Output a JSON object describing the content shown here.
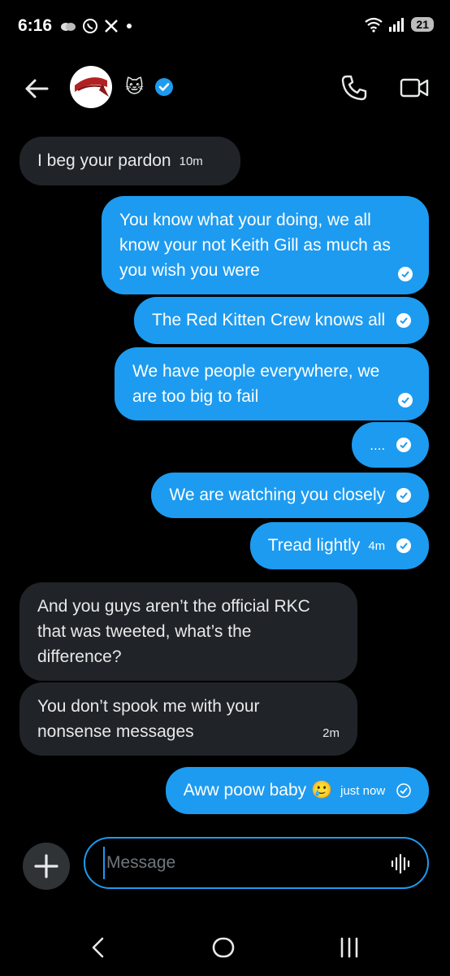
{
  "status_bar": {
    "time": "6:16",
    "icons": [
      "cloud-icon",
      "whatsapp-icon",
      "x-icon",
      "dot-icon"
    ],
    "battery": "21"
  },
  "header": {
    "contact_emoji": "🐱",
    "verified_color": "#1d9bf0"
  },
  "messages": [
    {
      "side": "in",
      "text": "I beg your pardon",
      "time": "10m"
    },
    {
      "side": "out",
      "text": "You know what your doing, we all know your not Keith Gill as much as you wish you were",
      "time": ""
    },
    {
      "side": "out",
      "text": "The Red Kitten Crew knows all",
      "time": ""
    },
    {
      "side": "out",
      "text": "We have people everywhere,  we are too big to fail",
      "time": ""
    },
    {
      "side": "out",
      "text": "....",
      "time": ""
    },
    {
      "side": "out",
      "text": "We are watching you closely",
      "time": ""
    },
    {
      "side": "out",
      "text": "Tread lightly",
      "time": "4m"
    },
    {
      "side": "in",
      "text": "And you guys aren’t the official RKC that was tweeted, what’s the difference?",
      "time": ""
    },
    {
      "side": "in",
      "text": "You don’t spook me with your nonsense messages",
      "time": "2m"
    },
    {
      "side": "out",
      "text": "Aww poow baby 🥲",
      "time": "just now"
    }
  ],
  "composer": {
    "placeholder": "Message"
  },
  "colors": {
    "accent": "#1d9bf0",
    "incoming_bubble": "#202327",
    "background": "#000000"
  }
}
